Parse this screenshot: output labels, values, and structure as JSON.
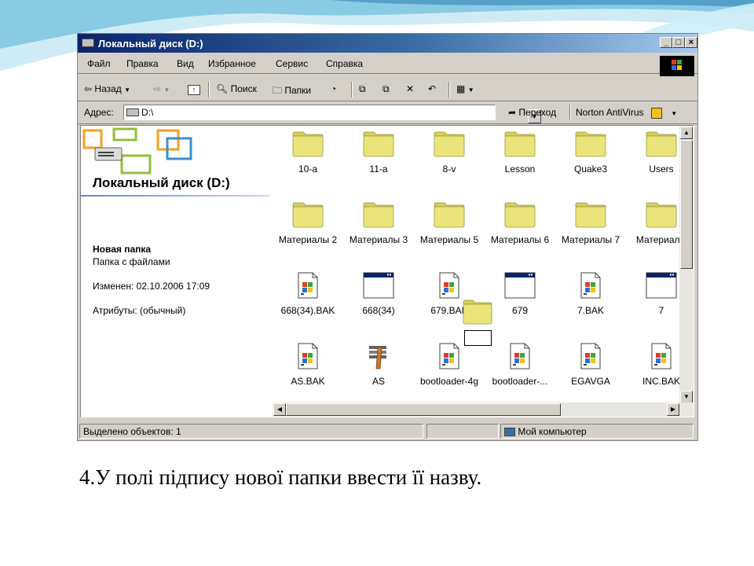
{
  "window": {
    "title": "Локальный диск (D:)",
    "minimize": "_",
    "maximize": "□",
    "close": "×"
  },
  "menu": [
    "Файл",
    "Правка",
    "Вид",
    "Избранное",
    "Сервис",
    "Справка"
  ],
  "toolbar": {
    "back": "Назад",
    "search": "Поиск",
    "folders": "Папки"
  },
  "address": {
    "label": "Адрес:",
    "value": "D:\\",
    "go": "Переход",
    "antivirus": "Norton AntiVirus"
  },
  "left_pane": {
    "title": "Локальный диск (D:)",
    "item_name": "Новая папка",
    "item_type": "Папка с файлами",
    "modified": "Изменен: 02.10.2006 17:09",
    "attributes": "Атрибуты: (обычный)"
  },
  "files": [
    {
      "label": "10-a",
      "icon": "folder-icon"
    },
    {
      "label": "11-a",
      "icon": "folder-icon"
    },
    {
      "label": "8-v",
      "icon": "folder-icon"
    },
    {
      "label": "Lesson",
      "icon": "folder-icon"
    },
    {
      "label": "Quake3",
      "icon": "folder-icon"
    },
    {
      "label": "Users",
      "icon": "folder-icon"
    },
    {
      "label": "Материалы 2",
      "icon": "folder-icon"
    },
    {
      "label": "Материалы 3",
      "icon": "folder-icon"
    },
    {
      "label": "Материалы 5",
      "icon": "folder-icon"
    },
    {
      "label": "Материалы 6",
      "icon": "folder-icon"
    },
    {
      "label": "Материалы 7",
      "icon": "folder-icon"
    },
    {
      "label": "Материалы",
      "icon": "folder-icon"
    },
    {
      "label": "668(34).BAK",
      "icon": "bak-file-icon"
    },
    {
      "label": "668(34)",
      "icon": "window-app-icon"
    },
    {
      "label": "679.BAK",
      "icon": "bak-file-icon"
    },
    {
      "label": "679",
      "icon": "window-app-icon"
    },
    {
      "label": "7.BAK",
      "icon": "bak-file-icon"
    },
    {
      "label": "7",
      "icon": "window-app-icon"
    },
    {
      "label": "AS.BAK",
      "icon": "bak-file-icon"
    },
    {
      "label": "AS",
      "icon": "exe-app-icon"
    },
    {
      "label": "bootloader-4g",
      "icon": "bak-file-icon"
    },
    {
      "label": "bootloader-...",
      "icon": "bak-file-icon"
    },
    {
      "label": "EGAVGA",
      "icon": "bak-file-icon"
    },
    {
      "label": "INC.BAK",
      "icon": "bak-file-icon"
    }
  ],
  "status": {
    "selected": "Выделено объектов: 1",
    "location": "Мой компьютер"
  },
  "caption": "4.У полі підпису нової папки ввести її назву.",
  "colors": {
    "folder": "#eae57a",
    "titlebar": "#0a246a",
    "slide_accent": "#8fd0e8"
  }
}
